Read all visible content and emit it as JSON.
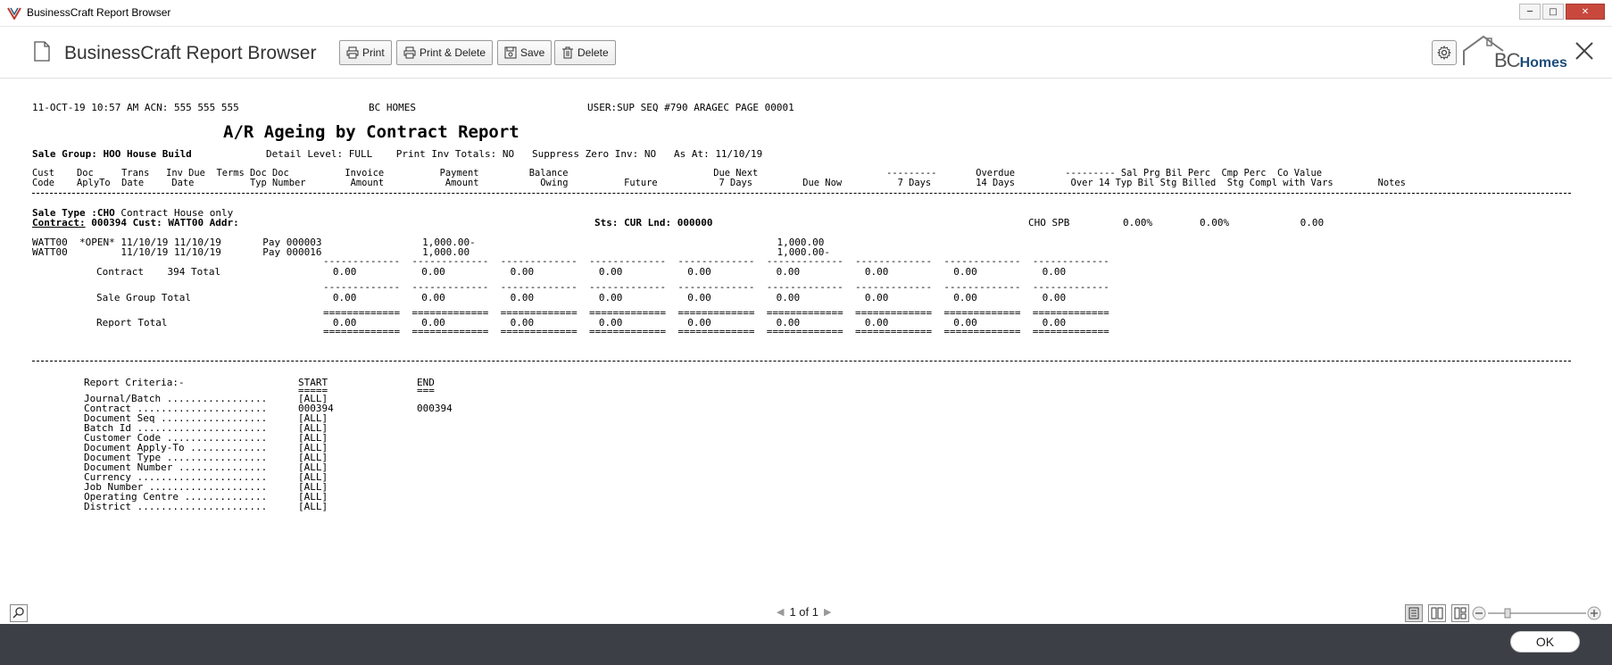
{
  "window": {
    "title": "BusinessCraft Report Browser"
  },
  "header": {
    "title": "BusinessCraft Report Browser",
    "buttons": {
      "print": "Print",
      "print_delete": "Print & Delete",
      "save": "Save",
      "delete": "Delete"
    },
    "brand": {
      "bc": "BC",
      "homes": "Homes"
    }
  },
  "report": {
    "line1_left": "11-OCT-19 10:57 AM ACN: 555 555 555",
    "line1_company": "BC HOMES",
    "line1_right": "USER:SUP SEQ #790 ARAGEC PAGE 00001",
    "title": "A/R Ageing by Contract Report",
    "sale_group": "Sale Group: HOO House Build",
    "options": "Detail Level: FULL    Print Inv Totals: NO   Suppress Zero Inv: NO   As At: 11/10/19",
    "hdr1": "Cust    Doc     Trans   Inv Due  Terms Doc Doc          Invoice          Payment         Balance                          Due Next                       ---------       Overdue         --------- Sal Prg Bil Perc  Cmp Perc  Co Value",
    "hdr2": "Code    AplyTo  Date     Date          Typ Number        Amount           Amount           Owing          Future           7 Days         Due Now          7 Days        14 Days          Over 14 Typ Bil Stg Billed  Stg Compl with Vars        Notes",
    "sale_type_label": "Sale Type :",
    "sale_type_value": "CHO",
    "sale_type_desc": " Contract House only",
    "contract_label": "Contract:",
    "contract_line": " 000394 Cust: WATT00 Addr:",
    "sts_line": "Sts: CUR Lnd: 000000",
    "contract_right": "CHO SPB         0.00%        0.00%            0.00",
    "row1": "WATT00  *OPEN* 11/10/19 11/10/19       Pay 000003                 1,000.00-                                                   1,000.00",
    "row2": "WATT00         11/10/19 11/10/19       Pay 000016                 1,000.00                                                    1,000.00-",
    "single_rule": "-------------  -------------  -------------  -------------  -------------  -------------  -------------  -------------  -------------",
    "double_rule": "=============  =============  =============  =============  =============  =============  =============  =============  =============",
    "contract_total": "Contract    394 Total                   0.00           0.00           0.00           0.00           0.00           0.00           0.00           0.00           0.00",
    "sale_group_total": "Sale Group Total                        0.00           0.00           0.00           0.00           0.00           0.00           0.00           0.00           0.00",
    "report_total": "Report Total                            0.00           0.00           0.00           0.00           0.00           0.00           0.00           0.00           0.00",
    "criteria": {
      "label": "Report Criteria:-",
      "start": "START",
      "end": "END",
      "start_ul": "=====",
      "end_ul": "===",
      "rows": [
        {
          "name": "Journal/Batch .................",
          "start": "[ALL]",
          "end": ""
        },
        {
          "name": "Contract ......................",
          "start": "000394",
          "end": "000394"
        },
        {
          "name": "Document Seq ..................",
          "start": "[ALL]",
          "end": ""
        },
        {
          "name": "Batch Id ......................",
          "start": "[ALL]",
          "end": ""
        },
        {
          "name": "Customer Code .................",
          "start": "[ALL]",
          "end": ""
        },
        {
          "name": "Document Apply-To .............",
          "start": "[ALL]",
          "end": ""
        },
        {
          "name": "Document Type .................",
          "start": "[ALL]",
          "end": ""
        },
        {
          "name": "Document Number ...............",
          "start": "[ALL]",
          "end": ""
        },
        {
          "name": "Currency ......................",
          "start": "[ALL]",
          "end": ""
        },
        {
          "name": "Job Number ....................",
          "start": "[ALL]",
          "end": ""
        },
        {
          "name": "Operating Centre ..............",
          "start": "[ALL]",
          "end": ""
        },
        {
          "name": "District ......................",
          "start": "[ALL]",
          "end": ""
        }
      ]
    }
  },
  "statusbar": {
    "page_text": "1 of 1"
  },
  "footer": {
    "ok_label": "OK"
  }
}
